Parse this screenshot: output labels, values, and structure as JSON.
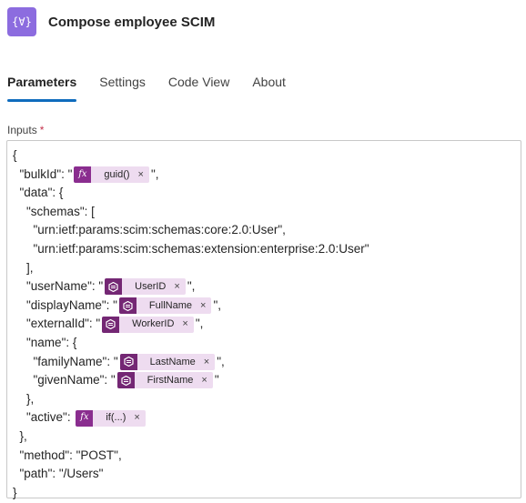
{
  "header": {
    "title": "Compose employee SCIM",
    "icon": "compose-icon",
    "icon_glyph": "{∀}",
    "icon_color": "#8c6cdf"
  },
  "tabs": [
    {
      "label": "Parameters",
      "active": true
    },
    {
      "label": "Settings",
      "active": false
    },
    {
      "label": "Code View",
      "active": false
    },
    {
      "label": "About",
      "active": false
    }
  ],
  "inputs": {
    "label": "Inputs",
    "required_marker": "*"
  },
  "tokens": {
    "guid": {
      "label": "guid()",
      "kind": "expression",
      "badge": "fx"
    },
    "userid": {
      "label": "UserID",
      "kind": "variable",
      "badge": "var-icon"
    },
    "fullname": {
      "label": "FullName",
      "kind": "variable",
      "badge": "var-icon"
    },
    "workerid": {
      "label": "WorkerID",
      "kind": "variable",
      "badge": "var-icon"
    },
    "lastname": {
      "label": "LastName",
      "kind": "variable",
      "badge": "var-icon"
    },
    "firstname": {
      "label": "FirstName",
      "kind": "variable",
      "badge": "var-icon"
    },
    "ifexpr": {
      "label": "if(...)",
      "kind": "expression",
      "badge": "fx"
    },
    "remove_glyph": "×"
  },
  "editor": {
    "l1": "{",
    "l2a": "  \"bulkId\": \"",
    "l2b": "\",",
    "l3": "  \"data\": {",
    "l4": "    \"schemas\": [",
    "l5": "      \"urn:ietf:params:scim:schemas:core:2.0:User\",",
    "l6": "      \"urn:ietf:params:scim:schemas:extension:enterprise:2.0:User\"",
    "l7": "    ],",
    "l8a": "    \"userName\": \"",
    "l8b": "\",",
    "l9a": "    \"displayName\": \"",
    "l9b": "\",",
    "l10a": "    \"externalId\": \"",
    "l10b": "\",",
    "l11": "    \"name\": {",
    "l12a": "      \"familyName\": \"",
    "l12b": "\",",
    "l13a": "      \"givenName\": \"",
    "l13b": "\"",
    "l14": "    },",
    "l15a": "    \"active\": ",
    "l16": "  },",
    "l17": "  \"method\": \"POST\",",
    "l18": "  \"path\": \"/Users\"",
    "l19": "}"
  },
  "colors": {
    "accent": "#0f6cbd",
    "token_bg": "#eedcf0",
    "fx_badge": "#8a2d8f",
    "var_badge": "#742774",
    "required": "#c4314b"
  }
}
